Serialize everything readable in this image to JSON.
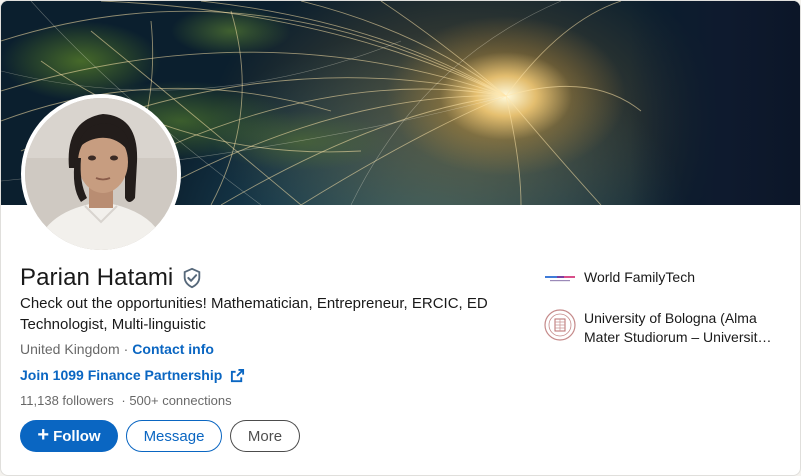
{
  "profile": {
    "name": "Parian Hatami",
    "headline": "Check out the opportunities! Mathematician, Entrepreneur, ERCIC, ED Technologist, Multi-linguistic",
    "location": "United Kingdom",
    "separator": "·",
    "contact_label": "Contact info",
    "website_label": "Join 1099 Finance Partnership",
    "followers": "11,138 followers",
    "connections": "500+ connections"
  },
  "actions": {
    "follow_icon": "+",
    "follow_label": "Follow",
    "message_label": "Message",
    "more_label": "More"
  },
  "organizations": [
    {
      "name": "World FamilyTech",
      "logo": "worldfamilytech-logo"
    },
    {
      "name": "University of Bologna (Alma Mater Studiorum – Universit…",
      "logo": "university-seal-logo"
    }
  ],
  "colors": {
    "accent": "#0a66c2",
    "text": "#191919",
    "muted": "#666666"
  },
  "icons": {
    "verified": "verified-shield-icon",
    "external_link": "external-link-icon"
  }
}
